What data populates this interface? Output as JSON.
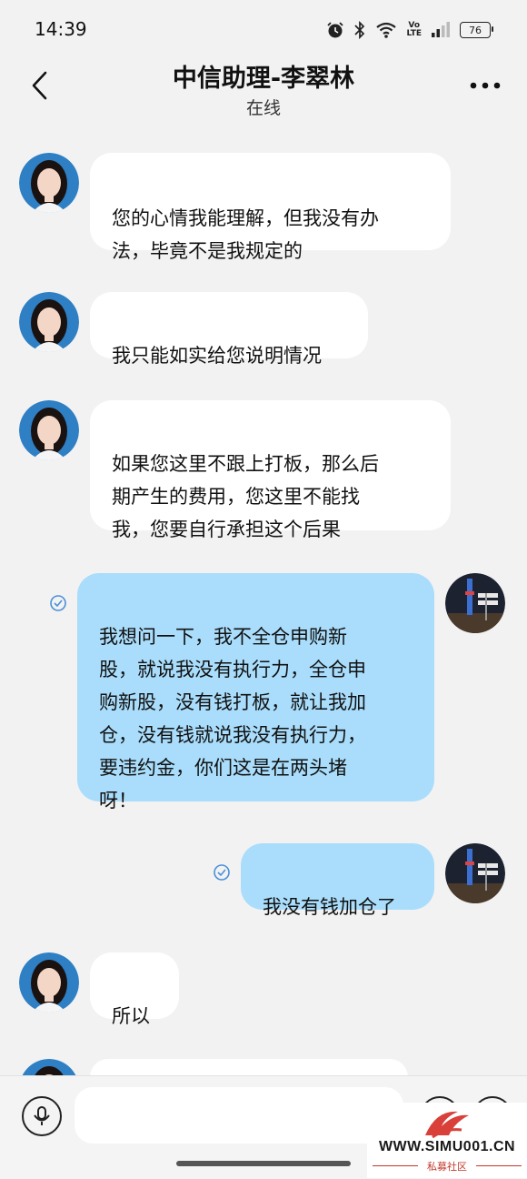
{
  "status_bar": {
    "time": "14:39",
    "volte_line1": "Vo",
    "volte_line2": "LTE",
    "battery": "76"
  },
  "header": {
    "title": "中信助理-李翠林",
    "subtitle": "在线"
  },
  "messages": [
    {
      "sender": "agent",
      "text": "您的心情我能理解，但我没有办\n法，毕竟不是我规定的"
    },
    {
      "sender": "agent",
      "text": "我只能如实给您说明情况"
    },
    {
      "sender": "agent",
      "text": "如果您这里不跟上打板，那么后\n期产生的费用，您这里不能找\n我，您要自行承担这个后果"
    },
    {
      "sender": "me",
      "text": "我想问一下，我不全仓申购新\n股，就说我没有执行力，全仓申\n购新股，没有钱打板，就让我加\n仓，没有钱就说我没有执行力，\n要违约金，你们这是在两头堵\n呀！",
      "read": true
    },
    {
      "sender": "me",
      "text": "我没有钱加仓了",
      "read": true
    },
    {
      "sender": "agent",
      "text": "所以"
    }
  ],
  "input": {
    "placeholder": ""
  },
  "watermark": {
    "url": "WWW.SIMU001.CN",
    "subtitle": "私募社区"
  },
  "colors": {
    "background": "#f2f2f2",
    "agent_bubble": "#ffffff",
    "my_bubble": "#a9ddfb",
    "read_check": "#4a90d9"
  }
}
